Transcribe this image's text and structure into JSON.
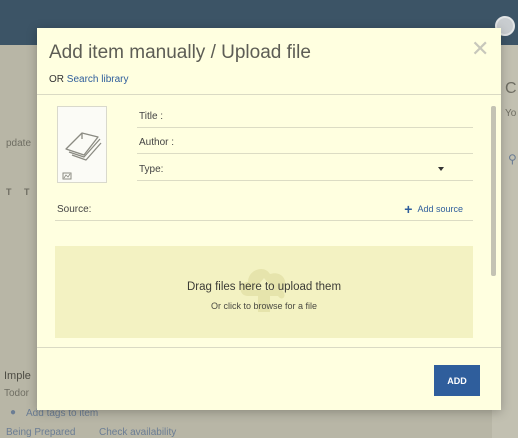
{
  "modal": {
    "title": "Add item manually / Upload file",
    "or_prefix": "OR",
    "search_library_link": "Search library",
    "fields": {
      "title_label": "Title :",
      "author_label": "Author :",
      "type_label": "Type:"
    },
    "source": {
      "label": "Source:",
      "add_label": "Add source"
    },
    "dropzone": {
      "main_text": "Drag files here to upload them",
      "sub_text": "Or click to browse for a file"
    },
    "add_button": "ADD"
  },
  "background": {
    "left_partial_1": "pdate",
    "left_partial_2": "Imple",
    "left_partial_3": "Todor",
    "left_partial_4": "Add tags to item",
    "left_partial_5": "Being Prepared",
    "left_partial_6": "Check availability",
    "right_partial_1": "C",
    "right_partial_2": "Yo"
  },
  "colors": {
    "header": "#3c5466",
    "modal_background": "#ffffe0",
    "accent": "#2f5e9c",
    "dropzone": "#f3f2c2"
  }
}
